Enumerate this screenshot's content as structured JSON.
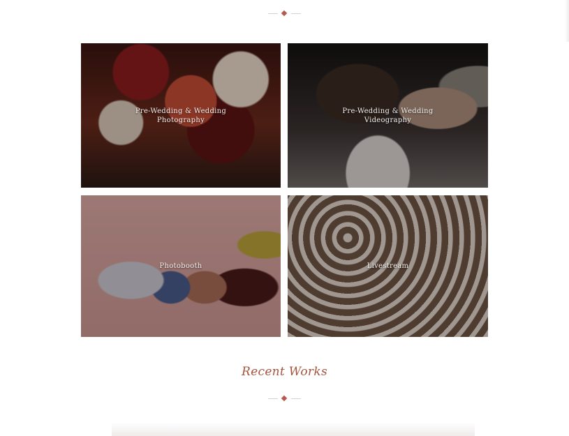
{
  "services": [
    {
      "label": "Pre-Wedding & Wedding\nPhotography"
    },
    {
      "label": "Pre-Wedding & Wedding\nVideography"
    },
    {
      "label": "Photobooth"
    },
    {
      "label": "Livestream"
    }
  ],
  "recent": {
    "title": "Recent Works"
  },
  "colors": {
    "accent": "#b65a4f",
    "title": "#a4533f"
  }
}
